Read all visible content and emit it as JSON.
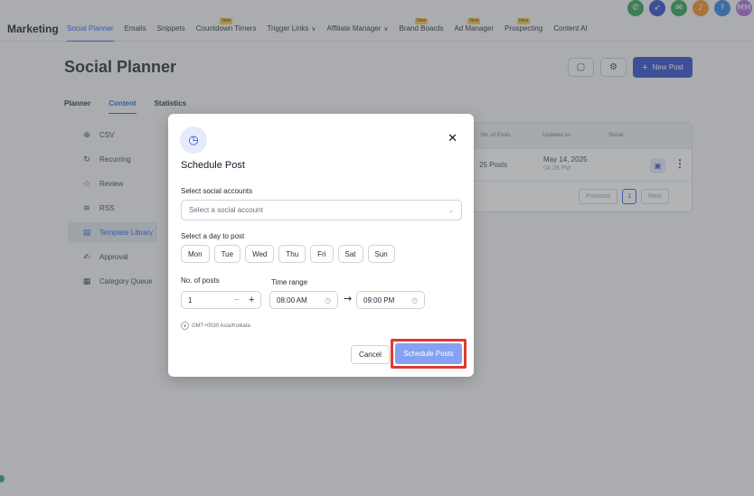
{
  "top_icons": [
    {
      "name": "phone-icon",
      "glyph": "✆",
      "color": "#2e9e4f"
    },
    {
      "name": "rocket-icon",
      "glyph": "➶",
      "color": "#2d4cc8"
    },
    {
      "name": "megaphone-icon",
      "glyph": "✉",
      "color": "#2e9e4f"
    },
    {
      "name": "bell-icon",
      "glyph": "♪",
      "color": "#f08a24"
    },
    {
      "name": "help-icon",
      "glyph": "?",
      "color": "#2d7fe0"
    },
    {
      "name": "avatar",
      "glyph": "MM",
      "color": "#a46bd1"
    }
  ],
  "nav": {
    "brand": "Marketing",
    "items": [
      {
        "label": "Social Planner",
        "active": true,
        "new": false,
        "caret": false
      },
      {
        "label": "Emails",
        "active": false,
        "new": false,
        "caret": false
      },
      {
        "label": "Snippets",
        "active": false,
        "new": false,
        "caret": false
      },
      {
        "label": "Countdown Timers",
        "active": false,
        "new": true,
        "caret": false
      },
      {
        "label": "Trigger Links",
        "active": false,
        "new": false,
        "caret": true
      },
      {
        "label": "Affiliate Manager",
        "active": false,
        "new": false,
        "caret": true
      },
      {
        "label": "Brand Boards",
        "active": false,
        "new": true,
        "caret": false
      },
      {
        "label": "Ad Manager",
        "active": false,
        "new": true,
        "caret": false
      },
      {
        "label": "Prospecting",
        "active": false,
        "new": true,
        "caret": false
      },
      {
        "label": "Content AI",
        "active": false,
        "new": false,
        "caret": false
      }
    ],
    "new_badge": "New"
  },
  "page": {
    "title": "Social Planner",
    "new_post_label": "New Post",
    "tabs": [
      {
        "label": "Planner",
        "active": false
      },
      {
        "label": "Content",
        "active": true
      },
      {
        "label": "Statistics",
        "active": false
      }
    ]
  },
  "sidebar": {
    "items": [
      {
        "label": "CSV",
        "icon": "upload-icon",
        "glyph": "⊕",
        "active": false
      },
      {
        "label": "Recurring",
        "icon": "recurring-icon",
        "glyph": "↻",
        "active": false
      },
      {
        "label": "Review",
        "icon": "star-icon",
        "glyph": "☆",
        "active": false
      },
      {
        "label": "RSS",
        "icon": "rss-icon",
        "glyph": "≋",
        "active": false
      },
      {
        "label": "Template Library",
        "icon": "template-icon",
        "glyph": "▤",
        "active": true
      },
      {
        "label": "Approval",
        "icon": "approval-icon",
        "glyph": "✍",
        "active": false
      },
      {
        "label": "Category Queue",
        "icon": "queue-icon",
        "glyph": "▦",
        "active": false
      }
    ]
  },
  "table": {
    "headers": [
      "No. of Posts",
      "Updated on",
      "Social"
    ],
    "row": {
      "posts": "25 Posts",
      "updated_date": "May 14, 2025",
      "updated_time": "04:28 PM"
    },
    "pager": {
      "previous": "Previous",
      "page": "1",
      "next": "Next"
    }
  },
  "modal": {
    "title": "Schedule Post",
    "accounts_label": "Select social accounts",
    "accounts_placeholder": "Select a social account",
    "day_label": "Select a day to post",
    "days": [
      "Mon",
      "Tue",
      "Wed",
      "Thu",
      "Fri",
      "Sat",
      "Sun"
    ],
    "posts_label": "No. of posts",
    "posts_value": "1",
    "time_label": "Time range",
    "time_start": "08:00 AM",
    "time_end": "09:00 PM",
    "timezone": "GMT+0530 Asia/Kolkata",
    "cancel_label": "Cancel",
    "schedule_label": "Schedule Posts"
  }
}
